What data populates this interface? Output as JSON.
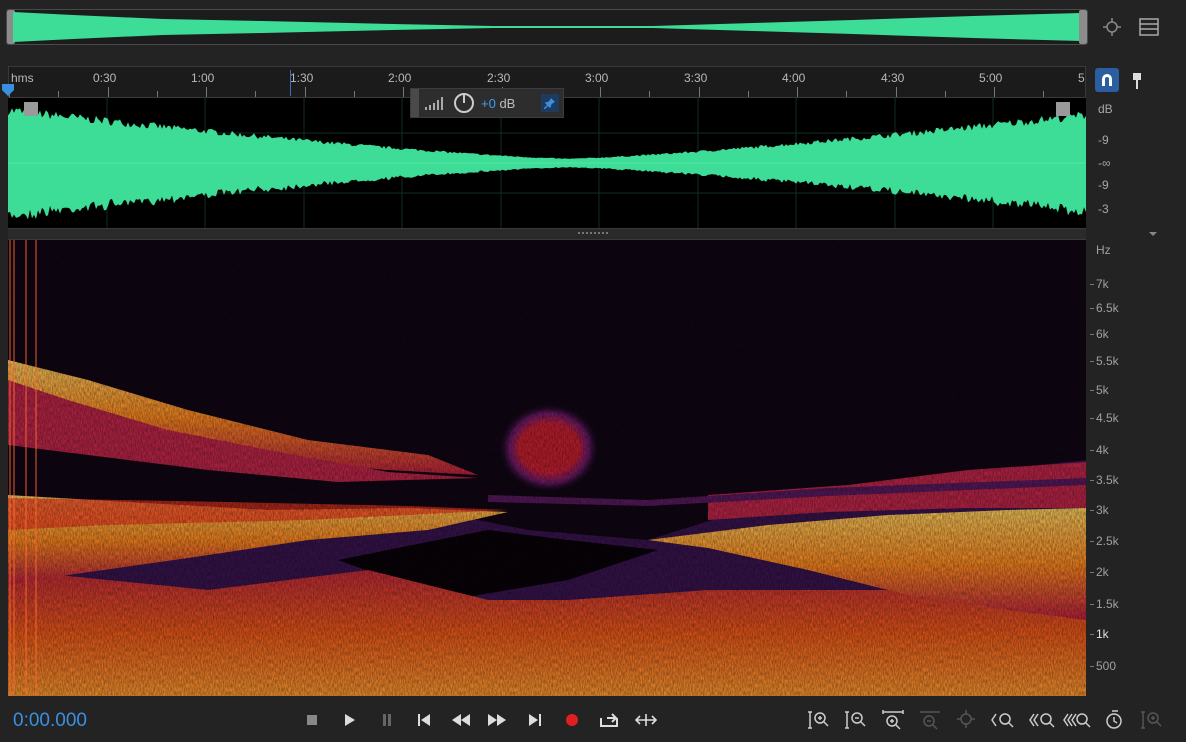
{
  "ruler": {
    "unit_label": "hms",
    "ticks": [
      "0:30",
      "1:00",
      "1:30",
      "2:00",
      "2:30",
      "3:00",
      "3:30",
      "4:00",
      "4:30",
      "5:00",
      "5"
    ]
  },
  "hud": {
    "gain_value": "+0",
    "gain_unit": "dB"
  },
  "db_scale": {
    "title": "dB",
    "labels": [
      "-9",
      "-∞",
      "-9",
      "-3"
    ]
  },
  "hz_scale": {
    "title": "Hz",
    "labels": [
      "7k",
      "6.5k",
      "6k",
      "5.5k",
      "5k",
      "4.5k",
      "4k",
      "3.5k",
      "3k",
      "2.5k",
      "2k",
      "1.5k",
      "1k",
      "500"
    ]
  },
  "transport": {
    "time": "0:00.000"
  },
  "icons": {
    "top_right": [
      "zoom-navigator-icon",
      "panel-menu-icon"
    ],
    "ruler_right": [
      "snap-magnet-icon",
      "marker-pin-icon"
    ],
    "transport": [
      "stop-icon",
      "play-icon",
      "pause-icon",
      "skip-to-start-icon",
      "rewind-icon",
      "fast-forward-icon",
      "skip-to-end-icon",
      "record-icon",
      "loop-playback-icon",
      "skip-selection-icon"
    ],
    "zoom": [
      "zoom-in-amplitude-icon",
      "zoom-out-amplitude-icon",
      "zoom-in-time-icon",
      "zoom-out-full-icon",
      "zoom-to-selection-icon",
      "zoom-in-left-icon",
      "zoom-in-right-icon",
      "zoom-in-both-icon",
      "zoom-reset-icon",
      "zoom-selection-disabled-icon"
    ]
  },
  "colors": {
    "waveform": "#3ddc97",
    "accent": "#3b8fe0",
    "record": "#e02020"
  }
}
